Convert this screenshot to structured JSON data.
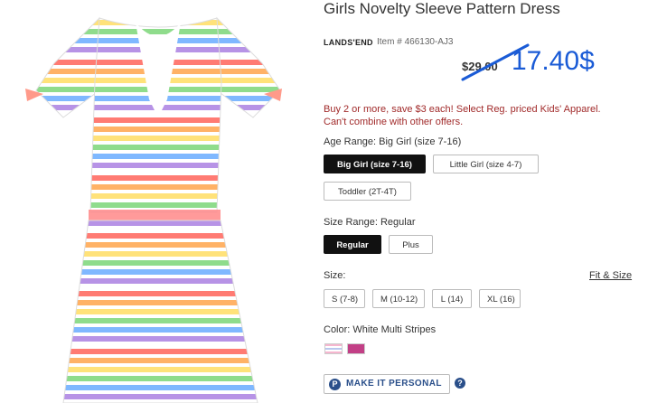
{
  "product": {
    "title": "Girls Novelty Sleeve Pattern Dress",
    "brand": "LANDS'END",
    "item_number": "Item # 466130-AJ3",
    "price_old": "$29.00",
    "price_new": "17.40$"
  },
  "promo": "Buy 2 or more, save $3 each! Select Reg. priced Kids' Apparel. Can't combine with other offers.",
  "age_range": {
    "label": "Age Range: Big Girl (size 7-16)",
    "options": [
      "Big Girl (size 7-16)",
      "Little Girl (size 4-7)",
      "Toddler (2T-4T)"
    ],
    "selected": "Big Girl (size 7-16)"
  },
  "size_range": {
    "label": "Size Range: Regular",
    "options": [
      "Regular",
      "Plus"
    ],
    "selected": "Regular"
  },
  "size": {
    "label": "Size:",
    "fit_link": "Fit & Size",
    "options": [
      "S (7-8)",
      "M (10-12)",
      "L (14)",
      "XL (16)"
    ]
  },
  "color": {
    "label": "Color: White Multi Stripes",
    "swatches": [
      {
        "name": "White Multi Stripes",
        "color": "#e9dff0"
      },
      {
        "name": "Pink Multi",
        "color": "#c23f86"
      }
    ]
  },
  "personalize": {
    "label": "MAKE IT PERSONAL",
    "icon_letter": "P",
    "help": "?"
  },
  "colors": {
    "accent_price": "#1a5bd6",
    "promo": "#a12a2a",
    "selected_button": "#111111"
  }
}
